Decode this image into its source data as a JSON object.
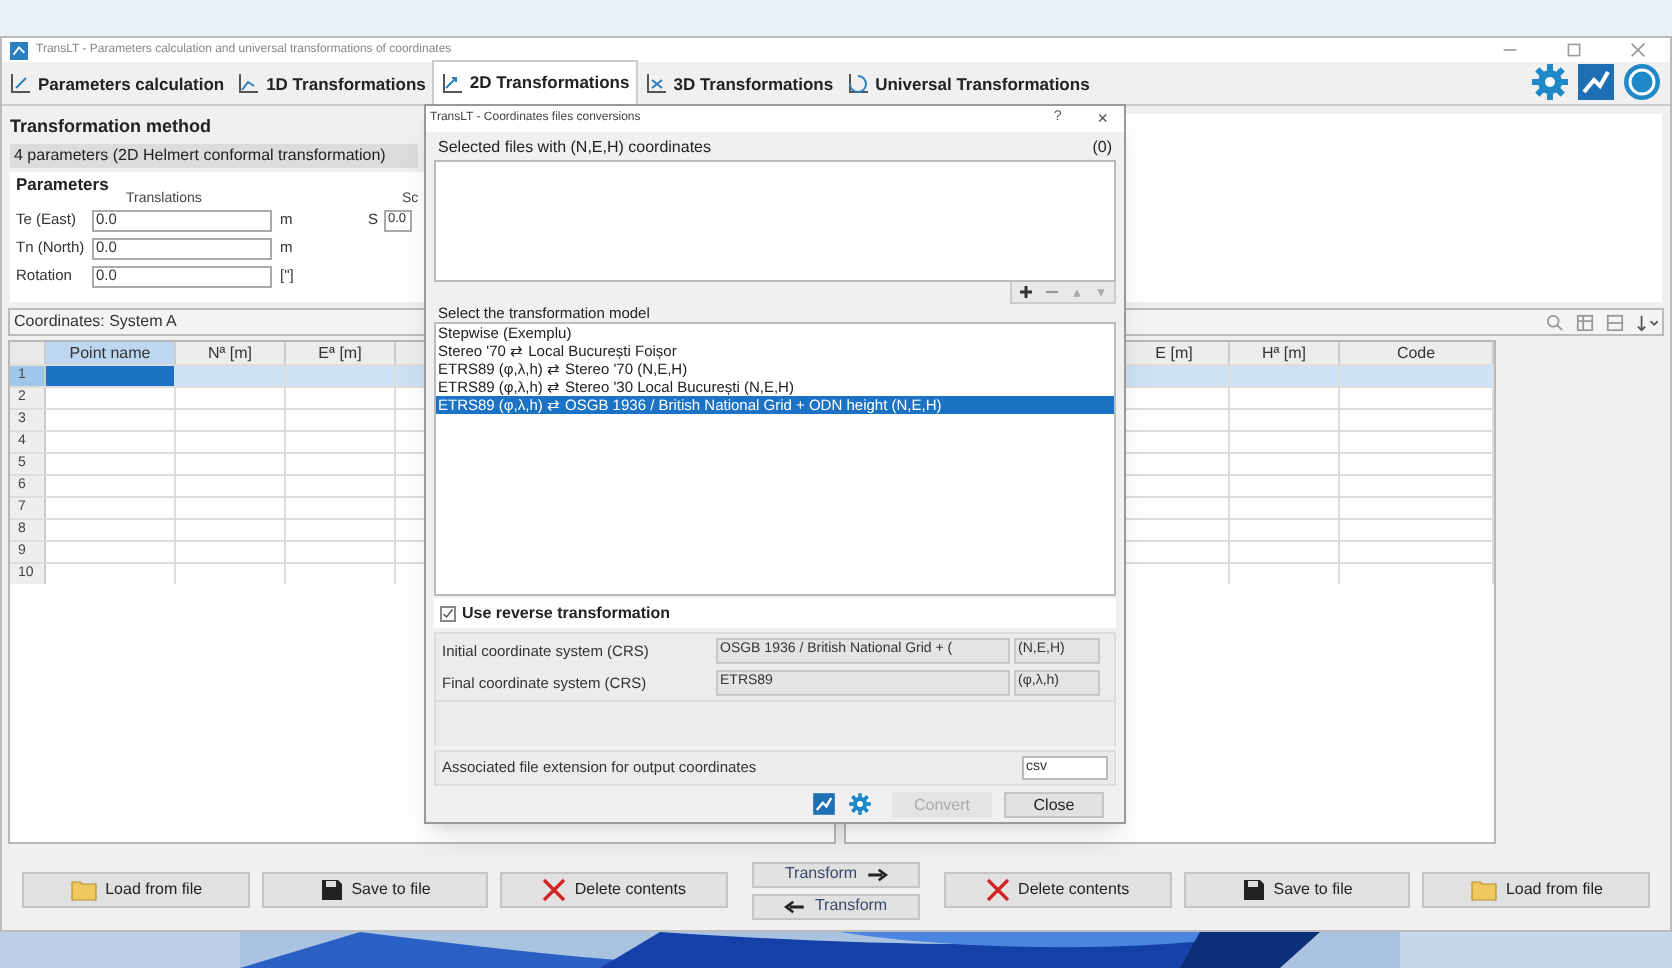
{
  "window": {
    "title": "TransLT - Parameters calculation and universal transformations of coordinates"
  },
  "tabs": [
    {
      "label": "Parameters calculation",
      "selected": false
    },
    {
      "label": "1D Transformations",
      "selected": false
    },
    {
      "label": "2D Transformations",
      "selected": true
    },
    {
      "label": "3D Transformations",
      "selected": false
    },
    {
      "label": "Universal Transformations",
      "selected": false
    }
  ],
  "method": {
    "heading": "Transformation method",
    "value": "4 parameters (2D Helmert conformal transformation)"
  },
  "parameters": {
    "heading": "Parameters",
    "translations_label": "Translations",
    "scale_label": "Sc",
    "fields": [
      {
        "label": "Te (East)",
        "value": "0.0",
        "unit": "m"
      },
      {
        "label": "Tn (North)",
        "value": "0.0",
        "unit": "m"
      },
      {
        "label": "Rotation",
        "value": "0.0",
        "unit": "[\"]"
      }
    ],
    "scale": {
      "label": "S",
      "value": "0.0"
    }
  },
  "coordinates": {
    "heading": "Coordinates: System A",
    "left_table": {
      "columns": [
        "Point name",
        "Nª [m]",
        "Eª [m]"
      ],
      "rows": [
        {
          "number": "1",
          "selected": true
        },
        {
          "number": "2",
          "selected": false
        },
        {
          "number": "3",
          "selected": false
        },
        {
          "number": "4",
          "selected": false
        },
        {
          "number": "5",
          "selected": false
        },
        {
          "number": "6",
          "selected": false
        },
        {
          "number": "7",
          "selected": false
        },
        {
          "number": "8",
          "selected": false
        },
        {
          "number": "9",
          "selected": false
        },
        {
          "number": "10",
          "selected": false
        }
      ]
    },
    "right_table": {
      "columns": [
        "E [m]",
        "Hª [m]",
        "Code"
      ],
      "rows": [
        {
          "selected": true
        },
        {
          "selected": false
        },
        {
          "selected": false
        },
        {
          "selected": false
        },
        {
          "selected": false
        },
        {
          "selected": false
        },
        {
          "selected": false
        },
        {
          "selected": false
        },
        {
          "selected": false
        },
        {
          "selected": false
        }
      ]
    }
  },
  "left_buttons": [
    "Load from file",
    "Save to file",
    "Delete contents"
  ],
  "transform_buttons": [
    {
      "label": "Transform",
      "kind": "forward"
    },
    {
      "label": "Transform",
      "kind": "backward"
    }
  ],
  "right_buttons": [
    "Delete contents",
    "Save to file",
    "Load from file"
  ],
  "dialog": {
    "title": "TransLT - Coordinates files conversions",
    "help": "?",
    "close": "×",
    "files_heading": "Selected files with (N,E,H) coordinates",
    "files_count": "(0)",
    "model_heading": "Select the transformation model",
    "models": [
      {
        "label": "Stepwise (Exemplu)",
        "selected": false
      },
      {
        "label": "Stereo '70 ⇄ Local București Foișor",
        "selected": false
      },
      {
        "label": "ETRS89 (φ,λ,h) ⇄ Stereo '70 (N,E,H)",
        "selected": false
      },
      {
        "label": "ETRS89 (φ,λ,h) ⇄ Stereo '30 Local București (N,E,H)",
        "selected": false
      },
      {
        "label": "ETRS89 (φ,λ,h) ⇄ OSGB 1936 / British National Grid + ODN height (N,E,H)",
        "selected": true
      }
    ],
    "reverse": {
      "label": "Use reverse transformation",
      "checked": true
    },
    "crs": [
      {
        "label": "Initial coordinate system (CRS)",
        "value": "OSGB 1936 / British National Grid + (",
        "unit": "(N,E,H)"
      },
      {
        "label": "Final coordinate system (CRS)",
        "value": "ETRS89",
        "unit": "(φ,λ,h)"
      }
    ],
    "extension": {
      "label": "Associated file extension for output coordinates",
      "value": "csv"
    },
    "convert": {
      "label": "Convert",
      "disabled": true
    },
    "close_button": "Close"
  }
}
